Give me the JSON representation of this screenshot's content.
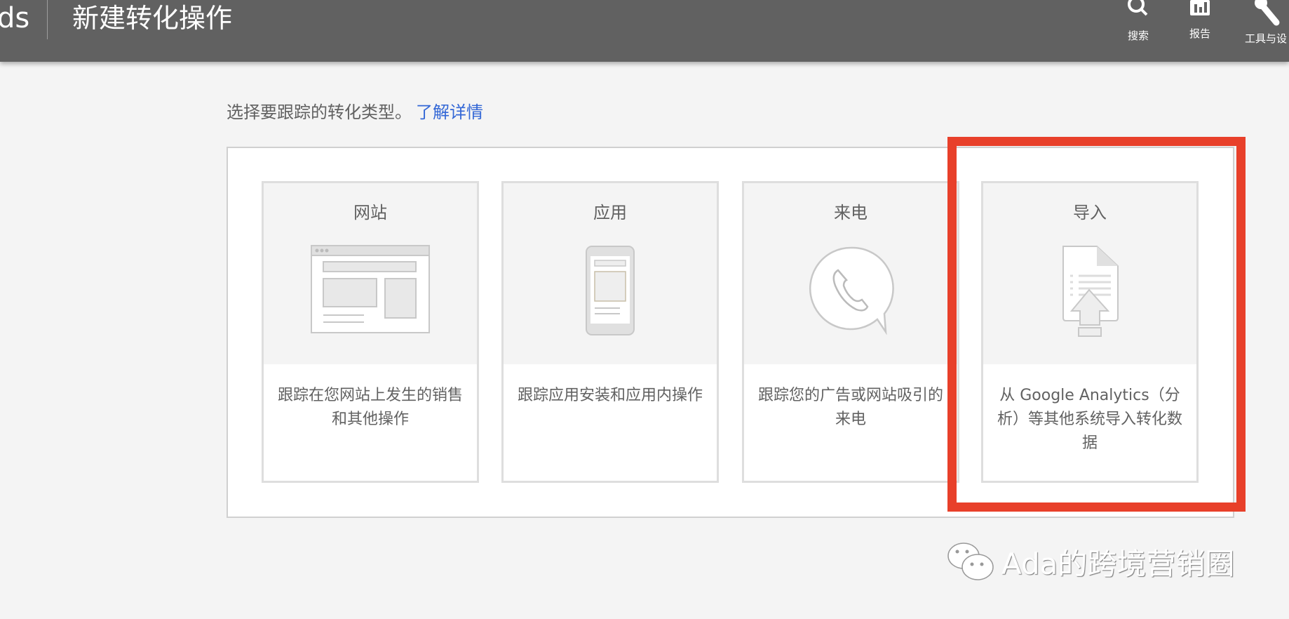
{
  "header": {
    "brand_fragment": "ds",
    "title": "新建转化操作",
    "nav": [
      {
        "label": "搜索",
        "icon": "search-icon"
      },
      {
        "label": "报告",
        "icon": "report-icon"
      },
      {
        "label": "工具与设",
        "icon": "wrench-icon"
      }
    ]
  },
  "intro": {
    "text": "选择要跟踪的转化类型。",
    "link": "了解详情"
  },
  "cards": [
    {
      "title": "网站",
      "desc": "跟踪在您网站上发生的销售和其他操作",
      "icon": "website-icon"
    },
    {
      "title": "应用",
      "desc": "跟踪应用安装和应用内操作",
      "icon": "app-icon"
    },
    {
      "title": "来电",
      "desc": "跟踪您的广告或网站吸引的来电",
      "icon": "phone-call-icon"
    },
    {
      "title": "导入",
      "desc": "从 Google Analytics（分析）等其他系统导入转化数据",
      "icon": "import-icon"
    }
  ],
  "highlight_color": "#e8402a",
  "watermark": "Ada的跨境营销圈"
}
